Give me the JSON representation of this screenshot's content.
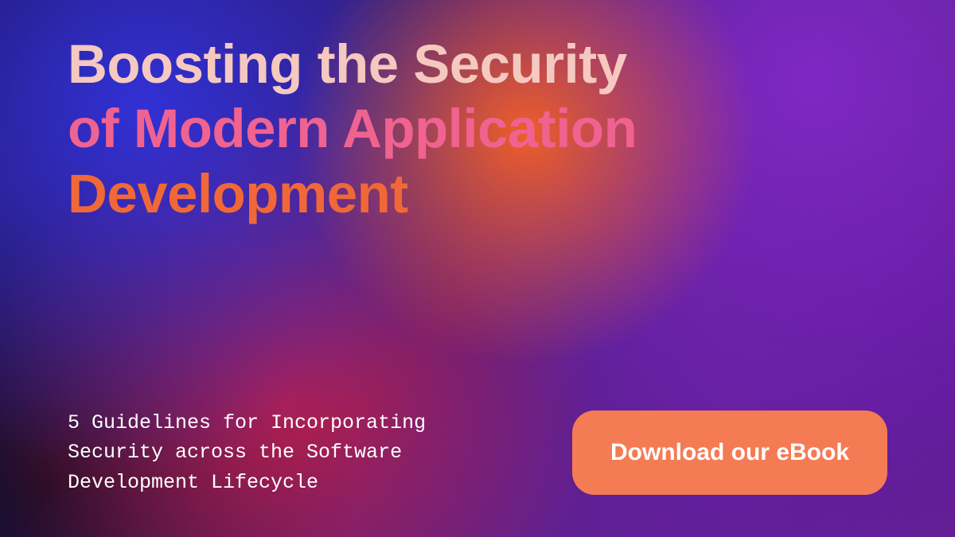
{
  "headline": {
    "line1": "Boosting the Security",
    "line2": "of Modern Application",
    "line3": "Development"
  },
  "subheading": "5 Guidelines for Incorporating Security across the Software Development Lifecycle",
  "cta": {
    "label": "Download our eBook"
  },
  "colors": {
    "headline_line1": "#f5c8c0",
    "headline_line2": "#f06290",
    "headline_line3": "#f06838",
    "subheading": "#ffffff",
    "button_bg": "#f57b54",
    "button_text": "#ffffff"
  }
}
